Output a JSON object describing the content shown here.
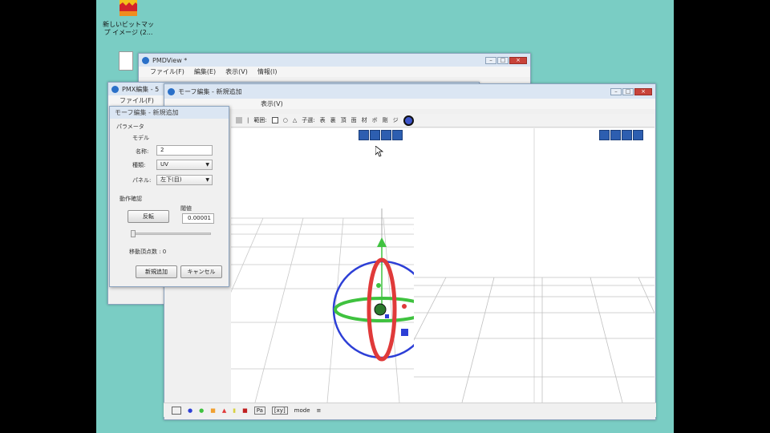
{
  "desktop": {
    "icon_label_line1": "新しいビットマッ",
    "icon_label_line2": "プ イメージ (2..."
  },
  "pmdview": {
    "title": "PMDView *",
    "menu": [
      "ファイル(F)",
      "編集(E)",
      "表示(V)",
      "情報(I)"
    ]
  },
  "pmx_editor": {
    "title": "PMX編集 - 5",
    "menu": [
      "ファイル(F)"
    ]
  },
  "morph_window": {
    "title": "モーフ編集 - 新規追加",
    "menu_view": "表示(V)",
    "toolbar": {
      "range_label": "範囲:",
      "select_label": "子選:",
      "buttons": [
        "表",
        "裏",
        "頂",
        "面",
        "材",
        "ボ",
        "剛",
        "ジ"
      ]
    },
    "status": {
      "mode_label": "mode",
      "btn1": "Pa",
      "btn2": "[xy]"
    }
  },
  "dialog": {
    "title": "モーフ編集 - 新規追加",
    "params_label": "パラメータ",
    "model_label": "モデル",
    "name_label": "名称:",
    "name_value": "2",
    "type_label": "種類:",
    "type_value": "UV",
    "panel_label": "パネル:",
    "panel_value": "左下(目)",
    "action_label": "動作確認",
    "invert_button": "反転",
    "threshold_label": "閾値",
    "threshold_value": "0.00001",
    "vertex_count_text": "移動頂点数 : 0",
    "add_button": "新規追加",
    "cancel_button": "キャンセル"
  },
  "colors": {
    "desktop": "#7acdc4",
    "gizmo_red": "#e03a3a",
    "gizmo_green": "#3fc23f",
    "gizmo_blue": "#2d3fd6"
  }
}
